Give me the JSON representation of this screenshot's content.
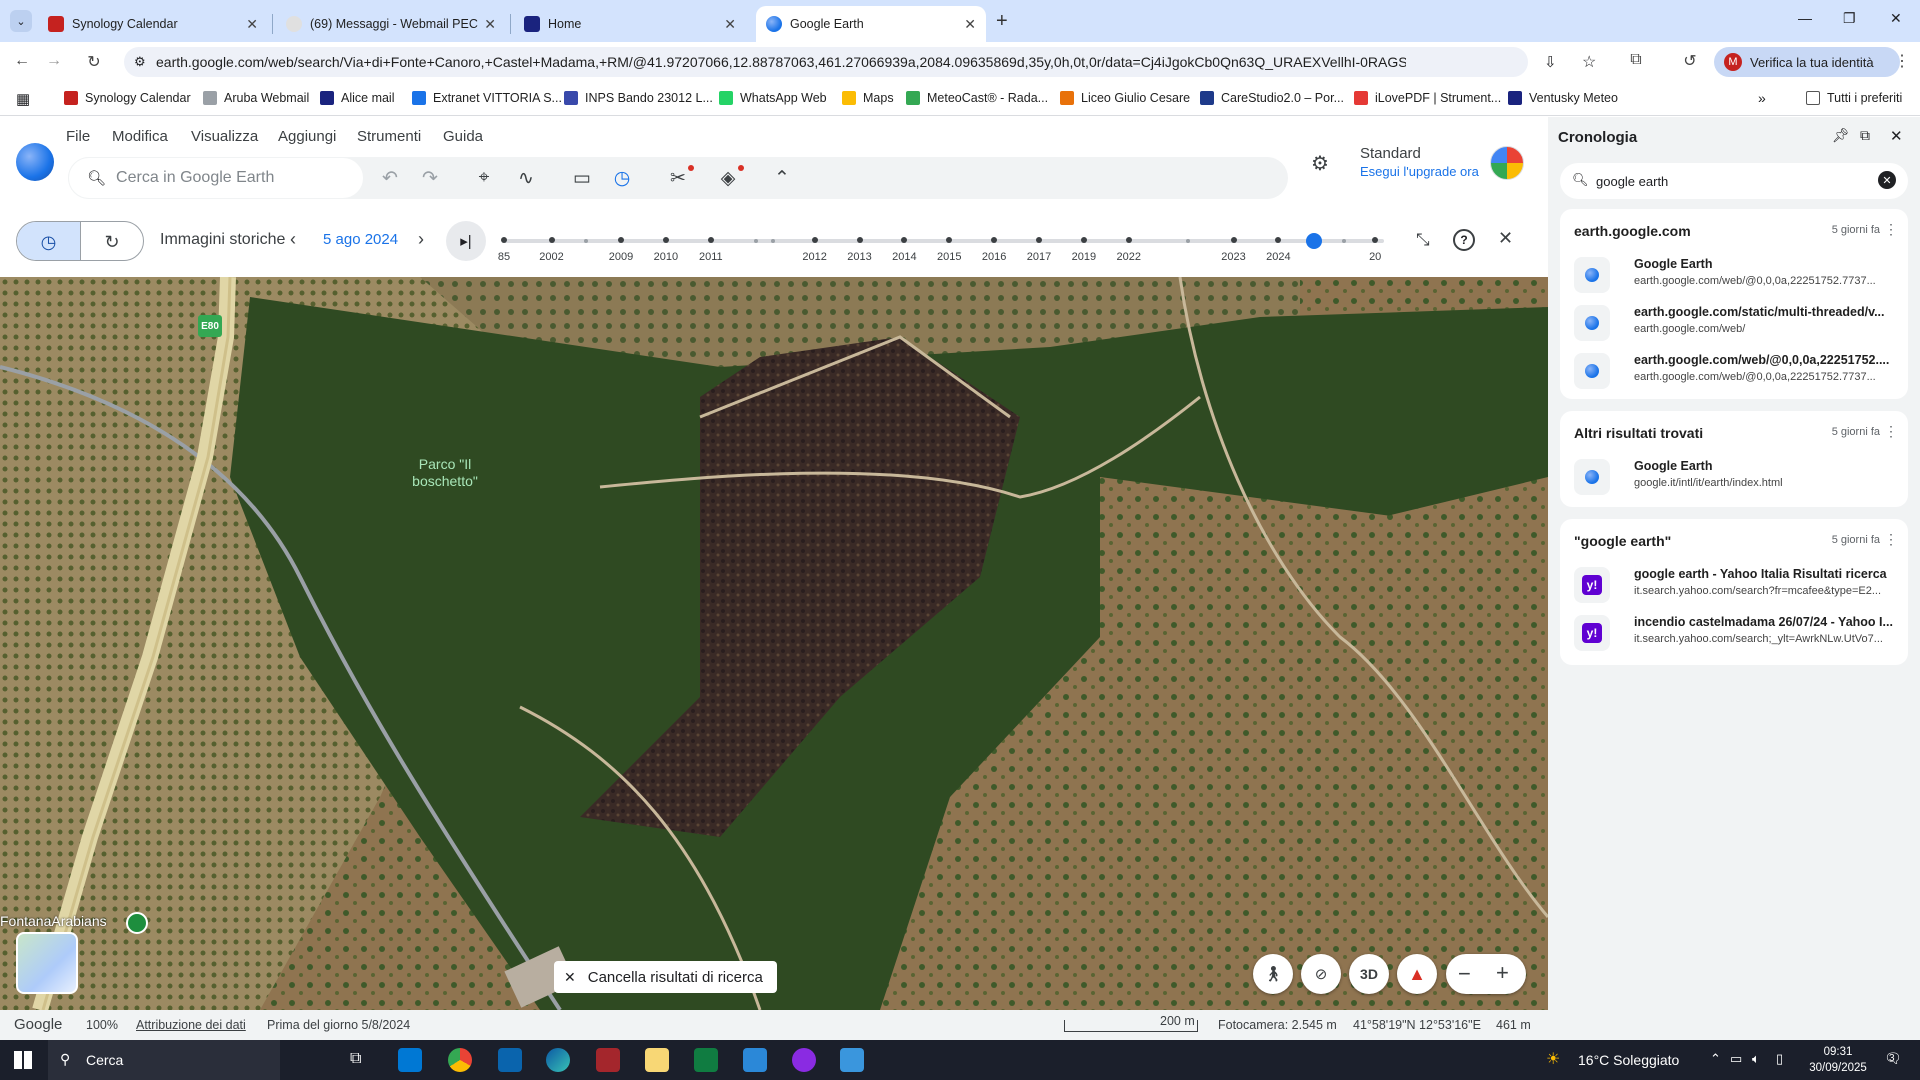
{
  "tabs": [
    {
      "label": "Synology Calendar"
    },
    {
      "label": "(69) Messaggi - Webmail PEC"
    },
    {
      "label": "Home"
    },
    {
      "label": "Google Earth"
    }
  ],
  "toolbar": {
    "url": "earth.google.com/web/search/Via+di+Fonte+Canoro,+Castel+Madama,+RM/@41.97207066,12.88787063,461.27066939a,2084.09635869d,35y,0h,0t,0r/data=Cj4iJgokCb0Qn63Q_URAEXVellhI-0RAGSRDAZwixyIAITGttp9IsCl...",
    "verify_label": "Verifica la tua identità",
    "avatar_letter": "M"
  },
  "bookmarks": [
    {
      "label": "Synology Calendar",
      "color": "#c5221f"
    },
    {
      "label": "Aruba Webmail",
      "color": "#9aa0a6"
    },
    {
      "label": "Alice mail",
      "color": "#1a237e"
    },
    {
      "label": "Extranet VITTORIA S...",
      "color": "#1a73e8"
    },
    {
      "label": "INPS Bando 23012 L...",
      "color": "#3949ab"
    },
    {
      "label": "WhatsApp Web",
      "color": "#25d366"
    },
    {
      "label": "Maps",
      "color": "#fbbc04"
    },
    {
      "label": "MeteoCast® - Rada...",
      "color": "#34a853"
    },
    {
      "label": "Liceo Giulio Cesare",
      "color": "#e8710a"
    },
    {
      "label": "CareStudio2.0 – Por...",
      "color": "#1e3a8a"
    },
    {
      "label": "iLovePDF | Strument...",
      "color": "#e53935"
    },
    {
      "label": "Ventusky Meteo",
      "color": "#1a237e"
    }
  ],
  "bookmarks_all": "Tutti i preferiti",
  "menu": [
    "File",
    "Modifica",
    "Visualizza",
    "Aggiungi",
    "Strumenti",
    "Guida"
  ],
  "search": {
    "placeholder": "Cerca in Google Earth"
  },
  "plan": {
    "title": "Standard",
    "upgrade": "Esegui l'upgrade ora"
  },
  "history": {
    "label": "Immagini storiche",
    "date": "5 ago 2024",
    "position": 0.92,
    "years": [
      {
        "label": "85",
        "pos": 0.0
      },
      {
        "label": "2002",
        "pos": 0.054
      },
      {
        "label": "2009",
        "pos": 0.133
      },
      {
        "label": "2010",
        "pos": 0.184
      },
      {
        "label": "2011",
        "pos": 0.235
      },
      {
        "label": "2012",
        "pos": 0.353
      },
      {
        "label": "2013",
        "pos": 0.404
      },
      {
        "label": "2014",
        "pos": 0.455
      },
      {
        "label": "2015",
        "pos": 0.506
      },
      {
        "label": "2016",
        "pos": 0.557
      },
      {
        "label": "2017",
        "pos": 0.608
      },
      {
        "label": "2019",
        "pos": 0.659
      },
      {
        "label": "2022",
        "pos": 0.71
      },
      {
        "label": "2023",
        "pos": 0.829
      },
      {
        "label": "2024",
        "pos": 0.88
      },
      {
        "label": "20",
        "pos": 0.99
      }
    ],
    "minor": [
      0.093,
      0.286,
      0.306,
      0.777,
      0.955
    ]
  },
  "map": {
    "place_label_1": "Parco \"Il",
    "place_label_2": "boschetto\"",
    "road_label": "E80",
    "poi_label": "FontanaArabians",
    "clear_search": "Cancella risultati di ricerca",
    "btn_3d": "3D"
  },
  "status": {
    "brand": "Google",
    "zoom": "100%",
    "attribution": "Attribuzione dei dati",
    "imagery": "Prima del giorno 5/8/2024",
    "scale": "200 m",
    "camera": "Fotocamera: 2.545 m",
    "coords": "41°58'19\"N 12°53'16\"E",
    "elevation": "461 m"
  },
  "side": {
    "title": "Cronologia",
    "query": "google earth",
    "groups": [
      {
        "title": "earth.google.com",
        "date": "5 giorni fa",
        "items": [
          {
            "t1": "Google Earth",
            "t2": "earth.google.com/web/@0,0,0a,22251752.7737...",
            "icon": "globe"
          },
          {
            "t1": "earth.google.com/static/multi-threaded/v...",
            "t2": "earth.google.com/web/",
            "icon": "globe"
          },
          {
            "t1": "earth.google.com/web/@0,0,0a,22251752....",
            "t2": "earth.google.com/web/@0,0,0a,22251752.7737...",
            "icon": "globe"
          }
        ]
      },
      {
        "title": "Altri risultati trovati",
        "date": "5 giorni fa",
        "items": [
          {
            "t1": "Google Earth",
            "t2": "google.it/intl/it/earth/index.html",
            "icon": "globe"
          }
        ]
      },
      {
        "title": "\"google earth\"",
        "date": "5 giorni fa",
        "items": [
          {
            "t1": "google earth - Yahoo Italia Risultati ricerca",
            "t2": "it.search.yahoo.com/search?fr=mcafee&type=E2...",
            "icon": "yahoo"
          },
          {
            "t1": "incendio castelmadama 26/07/24 - Yahoo I...",
            "t2": "it.search.yahoo.com/search;_ylt=AwrkNLw.UtVo7...",
            "icon": "yahoo"
          }
        ]
      }
    ]
  },
  "taskbar": {
    "search": "Cerca",
    "weather": "16°C  Soleggiato",
    "time": "09:31",
    "date": "30/09/2025",
    "notif": "3"
  }
}
